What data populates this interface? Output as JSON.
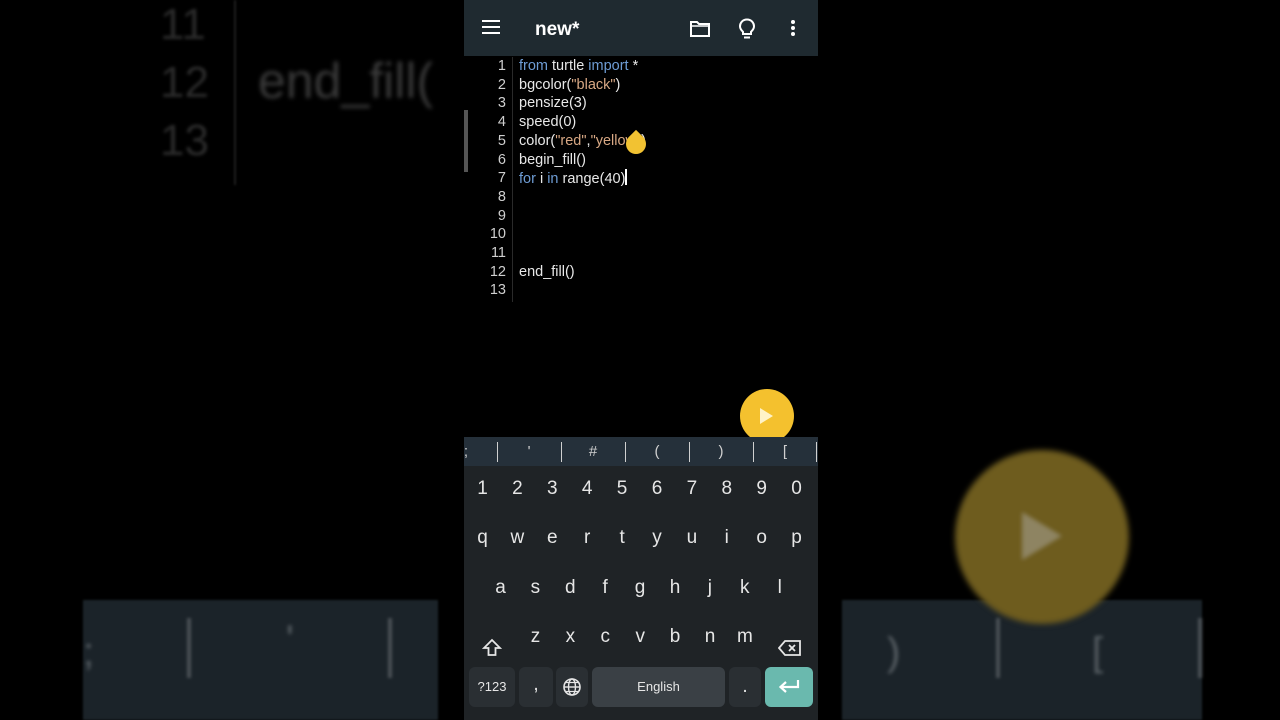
{
  "background": {
    "line_numbers": [
      "11",
      "12",
      "13"
    ],
    "code_fragment": "end_fill(",
    "symbols": [
      ";",
      "'",
      ")",
      "["
    ]
  },
  "appbar": {
    "title": "new*",
    "icons": [
      "menu-icon",
      "folder-icon",
      "lightbulb-icon",
      "more-vert-icon"
    ]
  },
  "editor": {
    "lines": [
      {
        "n": "1",
        "parts": [
          {
            "t": "from",
            "c": "kw"
          },
          {
            "t": " turtle ",
            "c": ""
          },
          {
            "t": "import",
            "c": "kw"
          },
          {
            "t": " *",
            "c": ""
          }
        ]
      },
      {
        "n": "2",
        "parts": [
          {
            "t": "bgcolor(",
            "c": ""
          },
          {
            "t": "\"black\"",
            "c": "str"
          },
          {
            "t": ")",
            "c": ""
          }
        ]
      },
      {
        "n": "3",
        "parts": [
          {
            "t": "pensize(3)",
            "c": ""
          }
        ]
      },
      {
        "n": "4",
        "parts": [
          {
            "t": "speed(0)",
            "c": ""
          }
        ]
      },
      {
        "n": "5",
        "parts": [
          {
            "t": "color(",
            "c": ""
          },
          {
            "t": "\"red\"",
            "c": "str"
          },
          {
            "t": ",",
            "c": ""
          },
          {
            "t": "\"yellow\"",
            "c": "str"
          },
          {
            "t": ")",
            "c": ""
          }
        ]
      },
      {
        "n": "6",
        "parts": [
          {
            "t": "begin_fill()",
            "c": ""
          }
        ]
      },
      {
        "n": "7",
        "parts": [
          {
            "t": "for",
            "c": "kw"
          },
          {
            "t": " i ",
            "c": ""
          },
          {
            "t": "in",
            "c": "kw"
          },
          {
            "t": " range(40)",
            "c": ""
          }
        ]
      },
      {
        "n": "8",
        "parts": []
      },
      {
        "n": "9",
        "parts": []
      },
      {
        "n": "10",
        "parts": []
      },
      {
        "n": "11",
        "parts": []
      },
      {
        "n": "12",
        "parts": [
          {
            "t": "end_fill()",
            "c": ""
          }
        ]
      },
      {
        "n": "13",
        "parts": []
      }
    ],
    "cursor_line": 7
  },
  "run_button": {
    "icon": "play-icon"
  },
  "symbol_bar": [
    ";",
    "'",
    "#",
    "(",
    ")",
    "["
  ],
  "keyboard": {
    "numbers": [
      "1",
      "2",
      "3",
      "4",
      "5",
      "6",
      "7",
      "8",
      "9",
      "0"
    ],
    "row1": [
      "q",
      "w",
      "e",
      "r",
      "t",
      "y",
      "u",
      "i",
      "o",
      "p"
    ],
    "row2": [
      "a",
      "s",
      "d",
      "f",
      "g",
      "h",
      "j",
      "k",
      "l"
    ],
    "row3": [
      "z",
      "x",
      "c",
      "v",
      "b",
      "n",
      "m"
    ],
    "symbols_key": "?123",
    "comma_key": ",",
    "space_label": "English",
    "period_key": ".",
    "icons": [
      "shift-icon",
      "backspace-icon",
      "globe-icon",
      "enter-icon"
    ],
    "accent": "#6ab9ae"
  },
  "colors": {
    "appbar": "#1f2a30",
    "keyword": "#6e9cd4",
    "string": "#d8a884",
    "fab": "#f4c12e"
  }
}
